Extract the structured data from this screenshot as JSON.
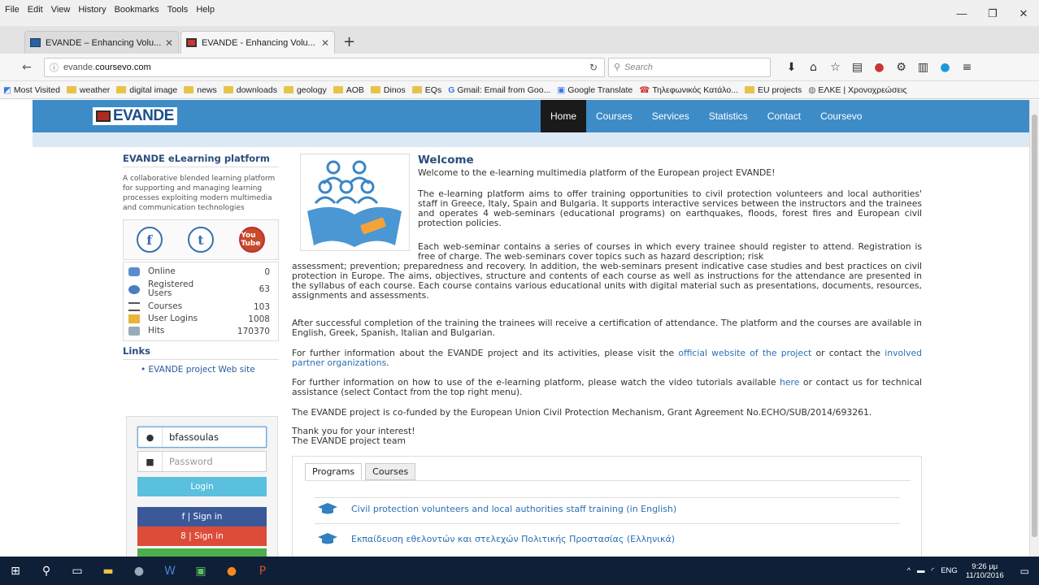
{
  "menubar": {
    "items": [
      "File",
      "Edit",
      "View",
      "History",
      "Bookmarks",
      "Tools",
      "Help"
    ]
  },
  "window_controls": {
    "minimize": "—",
    "restore": "❐",
    "close": "✕"
  },
  "tabs": [
    {
      "label": "EVANDE – Enhancing Volu...",
      "active": false
    },
    {
      "label": "EVANDE - Enhancing Volu...",
      "active": true
    }
  ],
  "newtab": "+",
  "address": {
    "prefix": "evande.",
    "domain": "coursevo.com",
    "search_placeholder": "Search"
  },
  "bookmarks": [
    "Most Visited",
    "weather",
    "digital image",
    "news",
    "downloads",
    "geology",
    "AOB",
    "Dinos",
    "EQs",
    "Gmail: Email from Goo...",
    "Google Translate",
    "Τηλεφωνικός Κατάλο...",
    "EU projects",
    "ΕΛΚΕ | Χρονοχρεώσεις"
  ],
  "site": {
    "logo_text": "EVANDE",
    "nav": [
      "Home",
      "Courses",
      "Services",
      "Statistics",
      "Contact",
      "Coursevo"
    ]
  },
  "sidebar": {
    "title": "EVANDE eLearning platform",
    "description": "A collaborative blended learning platform for supporting and managing learning processes exploiting modern multimedia and communication technologies",
    "social": {
      "facebook": "f",
      "twitter": "t",
      "youtube": "You Tube"
    },
    "stats": [
      {
        "label": "Online",
        "value": "0"
      },
      {
        "label": "Registered Users",
        "value": "63"
      },
      {
        "label": "Courses",
        "value": "103"
      },
      {
        "label": "User Logins",
        "value": "1008"
      },
      {
        "label": "Hits",
        "value": "170370"
      }
    ],
    "links_title": "Links",
    "links": [
      "• EVANDE project Web site"
    ]
  },
  "login": {
    "username_value": "bfassoulas",
    "password_placeholder": "Password",
    "login_label": "Login",
    "facebook_label": "f | Sign in",
    "google_label": "8 | Sign in"
  },
  "welcome": {
    "title": "Welcome",
    "intro": "Welcome to the e-learning multimedia platform of the European project EVANDE!",
    "p1": "The e-learning platform aims to offer training opportunities to civil protection volunteers and local authorities' staff in Greece, Italy, Spain and Bulgaria. It supports interactive services between the instructors and the trainees and operates 4 web-seminars (educational programs) on earthquakes, floods, forest fires and European civil protection policies.",
    "p2a": "Each web-seminar contains a series of courses in which every trainee should register to attend. Registration is free of charge. The web-seminars cover topics such as hazard description; risk",
    "p2b": "assessment; prevention; preparedness and recovery. In addition, the web-seminars present indicative case studies and best practices on civil protection in Europe. The aims, objectives, structure and contents of each course as well as instructions for the attendance are presented in the syllabus of each course. Each course contains various educational units with digital material such as presentations, documents, resources, assignments and assessments.",
    "p3": "After successful completion of the training the trainees will receive a certification of attendance. The platform and the courses are available in English, Greek, Spanish, Italian and Bulgarian.",
    "p4_pre": "For further information about the EVANDE project and its activities, please visit the ",
    "p4_link1": "official website of the project",
    "p4_mid": " or contact the ",
    "p4_link2": "involved partner organizations",
    "p4_end": ".",
    "p5_pre": "For further information on how to use of the e-learning platform, please watch the video tutorials available ",
    "p5_link": "here",
    "p5_end": " or contact us for technical assistance (select Contact from the top right menu).",
    "p6": "The EVANDE project is co-funded by the European Union Civil Protection Mechanism, Grant Agreement No.ECHO/SUB/2014/693261.",
    "p7a": "Thank you for your interest!",
    "p7b": "The EVANDE project team"
  },
  "programs": {
    "tabs": [
      "Programs",
      "Courses"
    ],
    "items": [
      "Civil protection volunteers and local authorities staff training (in English)",
      "Εκπαίδευση εθελοντών και στελεχών Πολιτικής Προστασίας (Ελληνικά)"
    ]
  },
  "taskbar": {
    "lang": "ENG",
    "time": "9:26 μμ",
    "date": "11/10/2016"
  },
  "colors": {
    "header_blue": "#3d8bc7",
    "taskbar": "#101f38",
    "link": "#2a6fb5"
  }
}
